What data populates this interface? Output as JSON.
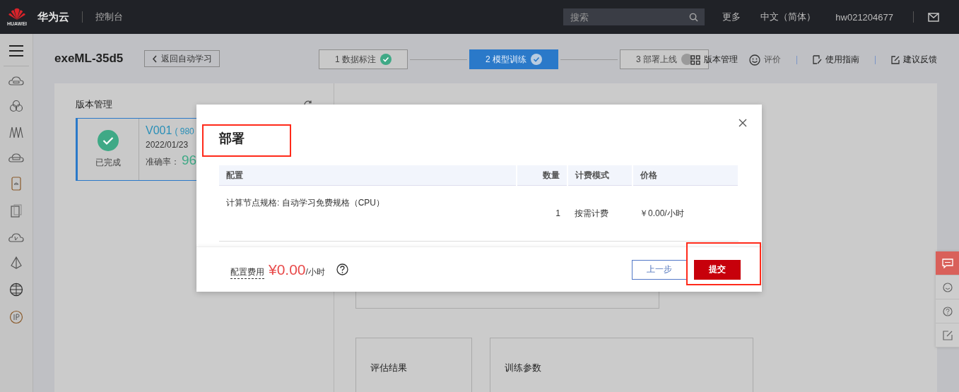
{
  "topbar": {
    "logo_text": "HUAWEI",
    "brand": "华为云",
    "console": "控制台",
    "search": {
      "placeholder": "搜索"
    },
    "links": [
      "更多",
      "中文（简体）",
      "hw021204677"
    ]
  },
  "header": {
    "title": "exeML-35d5",
    "back_button": "返回自动学习",
    "steps": [
      {
        "label": "1 数据标注",
        "selected": false,
        "completed": true
      },
      {
        "label": "2 模型训练",
        "selected": true,
        "completed": true
      },
      {
        "label": "3 部署上线",
        "selected": false,
        "completed": false
      }
    ],
    "actions": [
      "版本管理",
      "评价",
      "使用指南",
      "建议反馈"
    ]
  },
  "version_panel": {
    "title": "版本管理",
    "card": {
      "status": "已完成",
      "version": "V001",
      "meta": "( 980",
      "date": "2022/01/23",
      "accuracy_label": "准确率：",
      "accuracy": "96"
    }
  },
  "details": {
    "sections": [
      "评估结果",
      "训练参数"
    ]
  },
  "dialog": {
    "title": "部署",
    "columns": [
      "配置",
      "数量",
      "计费模式",
      "价格"
    ],
    "rows": [
      {
        "config": "计算节点规格: 自动学习免费规格（CPU）",
        "quantity": "1",
        "billing": "按需计费",
        "price": "￥0.00/小时"
      }
    ],
    "fee_label": "配置费用",
    "fee_amount": "¥0.00",
    "fee_unit": "/小时",
    "prev_button": "上一步",
    "submit_button": "提交"
  }
}
